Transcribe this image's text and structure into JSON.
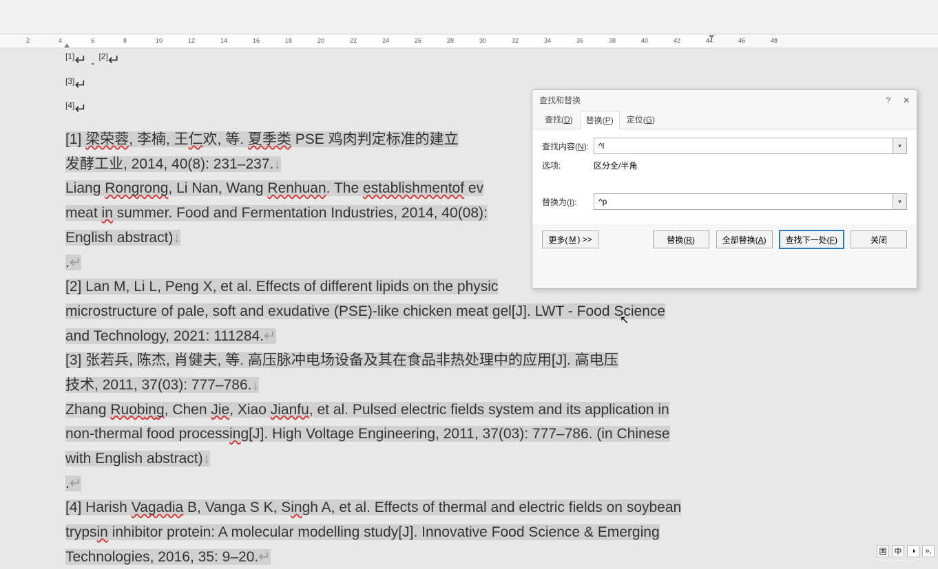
{
  "ruler": {
    "ticks": [
      2,
      4,
      6,
      8,
      10,
      12,
      14,
      16,
      18,
      20,
      22,
      24,
      26,
      28,
      30,
      32,
      34,
      36,
      38,
      40,
      42,
      44,
      46,
      48
    ]
  },
  "document": {
    "footnotes_top": [
      "[1]",
      "[2]",
      "[3]",
      "[4]"
    ],
    "body_lines": [
      "[1]  梁荣蓉,  李楠,  王仁欢,  等. 夏季类  PSE  鸡肉判定标准的建立",
      "发酵工业, 2014, 40(8): 231–237.↓",
      "Liang Rongrong, Li Nan, Wang Renhuan. The establishmentof ev",
      "meat in summer. Food and Fermentation Industries, 2014, 40(08): ",
      "English abstract)↓",
      ".↵",
      "[2] Lan M, Li L, Peng X, et al. Effects of different lipids on the physic",
      "microstructure of pale, soft and exudative (PSE)-like chicken meat gel[J]. LWT - Food Science ",
      "and Technology, 2021: 111284.↵",
      "[3]  张若兵,  陈杰,  肖健夫,  等.  高压脉冲电场设备及其在食品非热处理中的应用[J].  高电压",
      "技术, 2011, 37(03): 777–786.↓",
      "Zhang Ruobing, Chen Jie, Xiao Jianfu, et al. Pulsed electric fields system and its application in ",
      "non-thermal food processing[J]. High Voltage Engineering, 2011, 37(03): 777–786. (in Chinese ",
      "with English abstract)↓",
      ".↵",
      "[4] Harish Vagadia B, Vanga S K, Singh A, et al. Effects of thermal and electric fields on soybean ",
      "trypsin inhibitor protein: A molecular modelling study[J]. Innovative Food Science & Emerging ",
      "Technologies, 2016, 35: 9–20.↵"
    ],
    "wave_words": [
      "梁荣蓉",
      "仁",
      "夏季类",
      "Rongrong",
      "Renhuan",
      "establishmentof",
      "Ruobing",
      "Jie",
      "Jianfu",
      "in",
      "Vagadia"
    ]
  },
  "dialog": {
    "title": "查找和替换",
    "tabs": {
      "find": "查找(D)",
      "replace": "替换(P)",
      "goto": "定位(G)"
    },
    "labels": {
      "find_what": "查找内容(N):",
      "options": "选项:",
      "options_value": "区分全/半角",
      "replace_with": "替换为(I):"
    },
    "values": {
      "find": "^l",
      "replace": "^p"
    },
    "buttons": {
      "more": "更多(M) >>",
      "replace": "替换(R)",
      "replace_all": "全部替换(A)",
      "find_next": "查找下一处(F)",
      "close": "关闭"
    }
  },
  "status": {
    "items": [
      "国",
      "中",
      "◑",
      "»,"
    ]
  }
}
